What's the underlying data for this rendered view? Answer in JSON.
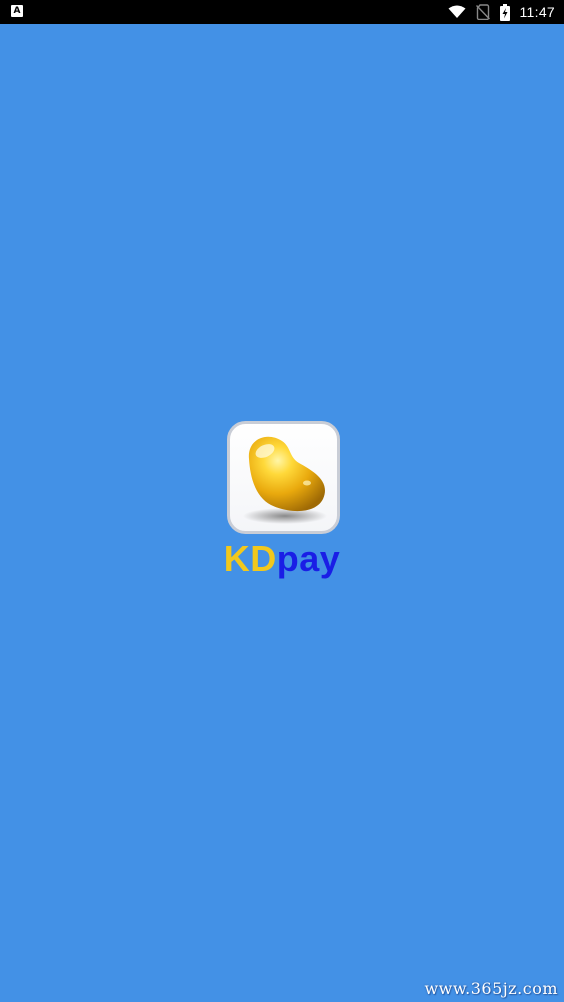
{
  "status_bar": {
    "left_icon": "A",
    "icons": [
      "wifi-icon",
      "no-sim-icon",
      "battery-charging-icon"
    ],
    "time": "11:47"
  },
  "splash": {
    "logo_icon": "golden-bean-icon",
    "brand_part_1": "KD",
    "brand_part_2": "pay"
  },
  "watermark": {
    "text": "www.365jz.com"
  },
  "colors": {
    "background": "#4391e6",
    "brand_kd": "#f2c81c",
    "brand_pay": "#1a1ee6"
  }
}
